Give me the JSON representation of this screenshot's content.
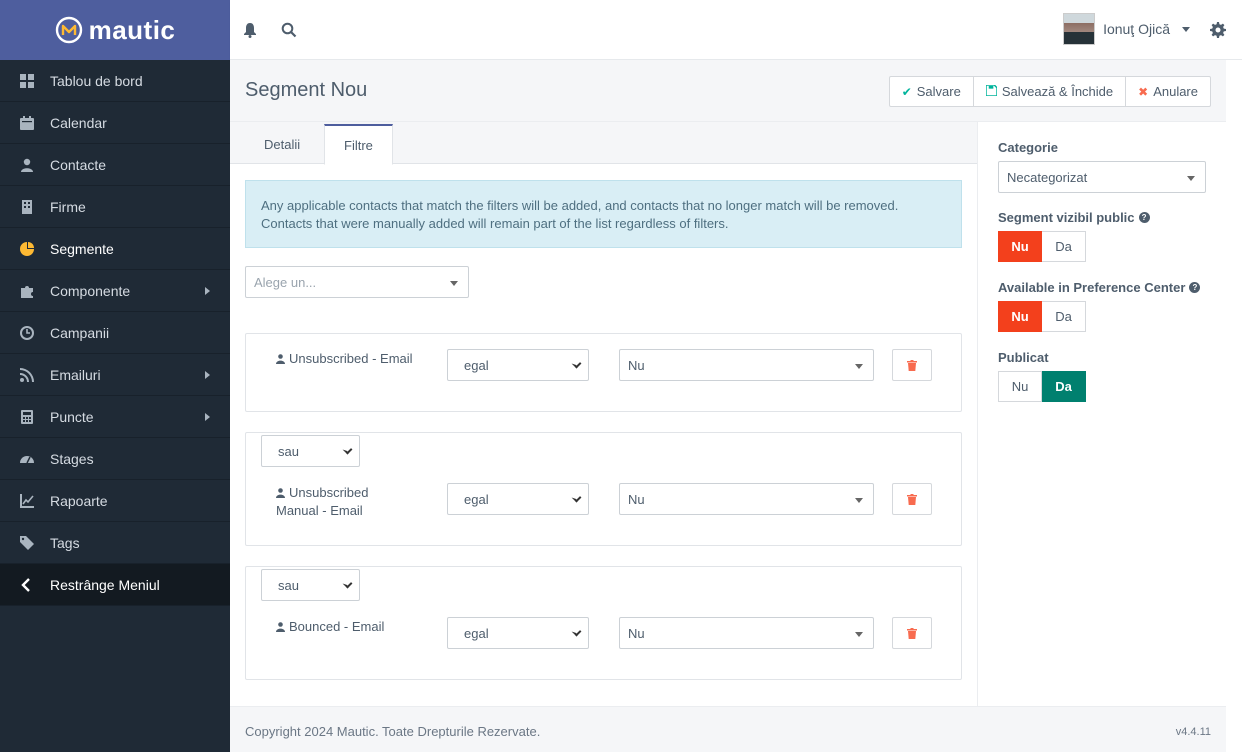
{
  "brand": {
    "name": "mautic"
  },
  "sidebar": {
    "items": [
      {
        "label": "Tablou de bord",
        "icon": "dashboard-icon"
      },
      {
        "label": "Calendar",
        "icon": "calendar-icon"
      },
      {
        "label": "Contacte",
        "icon": "user-icon"
      },
      {
        "label": "Firme",
        "icon": "building-icon"
      },
      {
        "label": "Segmente",
        "icon": "pie-chart-icon"
      },
      {
        "label": "Componente",
        "icon": "puzzle-icon"
      },
      {
        "label": "Campanii",
        "icon": "clock-icon"
      },
      {
        "label": "Emailuri",
        "icon": "rss-icon"
      },
      {
        "label": "Puncte",
        "icon": "calculator-icon"
      },
      {
        "label": "Stages",
        "icon": "tachometer-icon"
      },
      {
        "label": "Rapoarte",
        "icon": "line-chart-icon"
      },
      {
        "label": "Tags",
        "icon": "tag-icon"
      }
    ],
    "collapse_label": "Restrânge Meniul"
  },
  "topbar": {
    "user_name": "Ionuţ Ojică"
  },
  "page": {
    "title": "Segment Nou",
    "buttons": {
      "save": "Salvare",
      "save_close": "Salvează & Închide",
      "cancel": "Anulare"
    },
    "tabs": {
      "details": "Detalii",
      "filters": "Filtre"
    }
  },
  "filters": {
    "info": "Any applicable contacts that match the filters will be added, and contacts that no longer match will be removed. Contacts that were manually added will remain part of the list regardless of filters.",
    "choose_placeholder": "Alege un...",
    "rows": [
      {
        "glue": "",
        "field_line1": "Unsubscribed - Email",
        "field_line2": "",
        "operator": "egal",
        "value": "Nu"
      },
      {
        "glue": "sau",
        "field_line1": "Unsubscribed",
        "field_line2": "Manual - Email",
        "operator": "egal",
        "value": "Nu"
      },
      {
        "glue": "sau",
        "field_line1": "Bounced - Email",
        "field_line2": "",
        "operator": "egal",
        "value": "Nu"
      }
    ]
  },
  "properties": {
    "category_label": "Categorie",
    "category_value": "Necategorizat",
    "public_label": "Segment vizibil public",
    "preference_label": "Available in Preference Center",
    "published_label": "Publicat",
    "no": "Nu",
    "yes": "Da",
    "public_value": "Nu",
    "preference_value": "Nu",
    "published_value": "Da"
  },
  "footer": {
    "copyright": "Copyright 2024 Mautic. Toate Drepturile Rezervate.",
    "version": "v4.4.11"
  }
}
